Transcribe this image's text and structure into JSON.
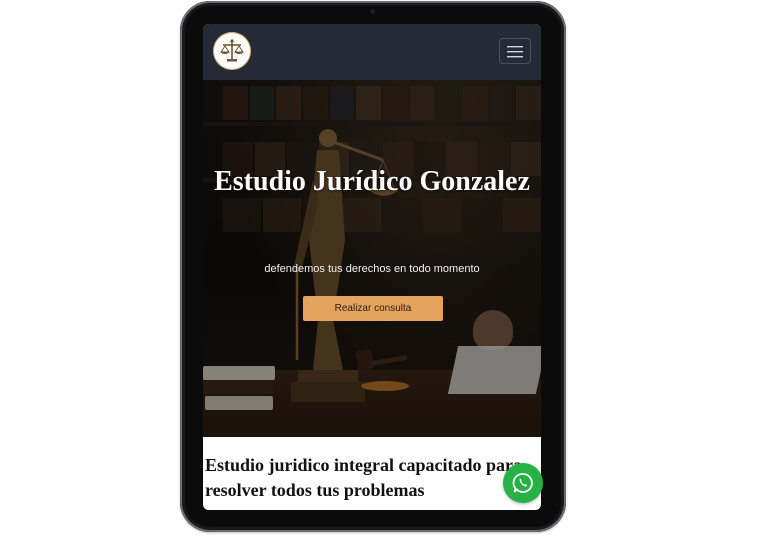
{
  "navbar": {
    "logo_icon": "scales-of-justice-icon",
    "menu_icon": "hamburger-menu-icon"
  },
  "hero": {
    "title": "Estudio Jurídico Gonzalez",
    "subtitle": "defendemos tus derechos en todo momento",
    "cta_label": "Realizar consulta"
  },
  "section": {
    "title": "Estudio juridico integral capacitado para resolver todos tus problemas"
  },
  "floating": {
    "whatsapp_icon": "whatsapp-icon"
  },
  "colors": {
    "navbar": "#252a36",
    "accent": "#e5a45e",
    "whatsapp": "#27b245"
  }
}
